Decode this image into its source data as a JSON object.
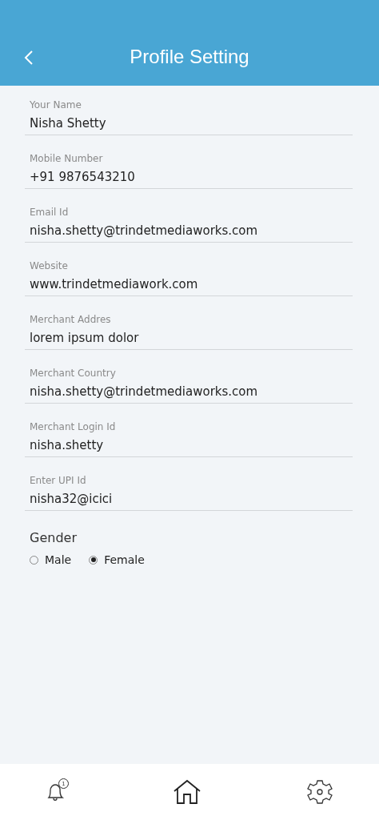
{
  "header": {
    "title": "Profile Setting"
  },
  "fields": [
    {
      "label": "Your Name",
      "value": "Nisha Shetty"
    },
    {
      "label": "Mobile Number",
      "value": "+91 9876543210"
    },
    {
      "label": "Email Id",
      "value": "nisha.shetty@trindetmediaworks.com"
    },
    {
      "label": "Website",
      "value": "www.trindetmediawork.com"
    },
    {
      "label": "Merchant Addres",
      "value": "lorem ipsum dolor"
    },
    {
      "label": "Merchant Country",
      "value": "nisha.shetty@trindetmediaworks.com"
    },
    {
      "label": "Merchant Login Id",
      "value": "nisha.shetty"
    },
    {
      "label": "Enter UPI Id",
      "value": "nisha32@icici"
    }
  ],
  "gender": {
    "label": "Gender",
    "options": [
      {
        "label": "Male",
        "selected": false
      },
      {
        "label": "Female",
        "selected": true
      }
    ]
  },
  "bottom_nav": {
    "notification_badge": "1"
  }
}
